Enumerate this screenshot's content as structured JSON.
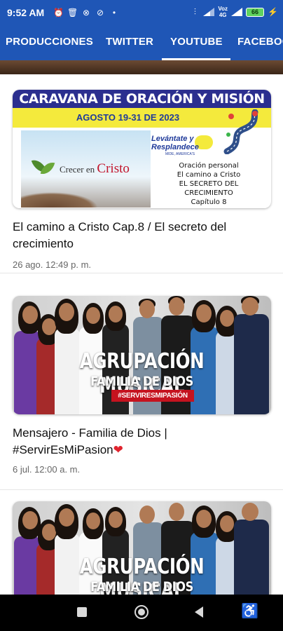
{
  "status_bar": {
    "time": "9:52 AM",
    "left_icons": [
      "alarm-icon",
      "trash-icon",
      "blocked-icon",
      "do-not-disturb-icon",
      "dot-icon"
    ],
    "right_icons": [
      "vibrate-icon",
      "wifi-signal-icon",
      "voz-lte-icon",
      "cell-signal-icon",
      "battery-icon",
      "charging-icon"
    ],
    "voz_label": "Voz",
    "voz_sub": "4G",
    "battery_level": "66",
    "bg_color": "#1f56b6"
  },
  "tabs": [
    {
      "label": "PRODUCCIONES",
      "active": false
    },
    {
      "label": "TWITTER",
      "active": false
    },
    {
      "label": "YOUTUBE",
      "active": true
    },
    {
      "label": "FACEBOOK",
      "active": false
    }
  ],
  "videos": [
    {
      "title": "El camino a Cristo Cap.8 / El secreto del crecimiento",
      "date": "26 ago. 12:49 p. m.",
      "thumbnail": {
        "banner": "CARAVANA DE ORACIÓN Y MISIÓN",
        "date_range": "AGOSTO 19-31 DE 2023",
        "photo_text_small": "Crecer en",
        "photo_text_big": "Cristo",
        "logo_line1": "Levántate y",
        "logo_line2": "Resplandece",
        "logo_small": "MIDE, AMERICA'S",
        "desc_lines": [
          "Oración personal",
          "El camino a Cristo",
          "EL SECRETO DEL",
          "CRECIMIENTO",
          "Capítulo 8"
        ]
      }
    },
    {
      "title_line1": "Mensajero - Familia de Dios |",
      "title_line2": "#ServirEsMiPasion",
      "title_emoji": "❤",
      "date": "6 jul. 12:00 a. m.",
      "thumbnail": {
        "title1": "AGRUPACIÓN MUSICAL",
        "title2": "FAMILIA DE DIOS",
        "tag": "#SERVIRESMIPASIÓN"
      }
    },
    {
      "thumbnail": {
        "title1": "AGRUPACIÓN MUSICAL",
        "title2": "FAMILIA DE DIOS"
      }
    }
  ],
  "nav": {
    "recent": "recent-apps-icon",
    "home": "home-icon",
    "back": "back-icon",
    "accessibility": "accessibility-icon"
  },
  "colors": {
    "primary": "#1f56b6",
    "banner_navy": "#2b2f8f",
    "banner_yellow": "#f4ea3c",
    "tag_red": "#c5131f"
  }
}
